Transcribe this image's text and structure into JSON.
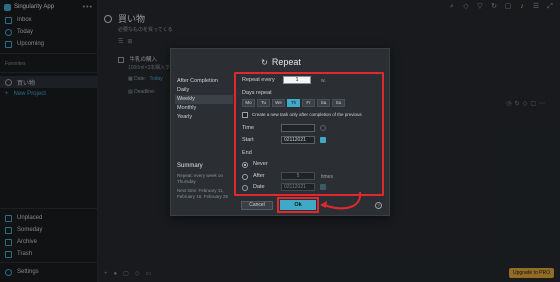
{
  "app": {
    "title": "Singularity App"
  },
  "sidebar": {
    "items": [
      {
        "label": "Inbox"
      },
      {
        "label": "Today"
      },
      {
        "label": "Upcoming"
      }
    ],
    "favorites_label": "Favorites",
    "projects": [
      {
        "label": "買い物"
      }
    ],
    "new_project_label": "New Project",
    "bottom_items": [
      {
        "label": "Unplaced"
      },
      {
        "label": "Someday"
      },
      {
        "label": "Archive"
      },
      {
        "label": "Trash"
      }
    ],
    "settings_label": "Settings"
  },
  "main": {
    "project_title": "買い物",
    "project_subtitle": "必要なものを買ってくる",
    "task_title": "牛乳の購入",
    "task_note": "1000ml×3本購入す",
    "date_label": "Date:",
    "date_value": "Today",
    "deadline_label": "Deadline:",
    "upgrade_label": "Upgrade to PRO"
  },
  "modal": {
    "title": "Repeat",
    "frequencies": [
      "After Completion",
      "Daily",
      "Weekly",
      "Monthly",
      "Yearly"
    ],
    "selected_frequency": "Weekly",
    "repeat_every_label": "Repeat every",
    "repeat_every_value": "1",
    "repeat_every_unit": "w.",
    "days_repeat_label": "Days repeat",
    "days": [
      "Mo",
      "Tu",
      "We",
      "Th",
      "Fr",
      "Sa",
      "Su"
    ],
    "selected_day": "Th",
    "create_new_label": "Create a new task only after completion of the previous",
    "time_label": "Time",
    "start_label": "Start",
    "start_value": "02112021",
    "end_label": "End",
    "never_label": "Never",
    "after_label": "After",
    "after_value": "5",
    "after_unit": "times",
    "date_label": "Date",
    "date_value": "02112021",
    "summary_head": "Summary",
    "summary_text": "Repeat: every week on Thursday",
    "next_time_text": "Next time: February 11, February 18, February 25",
    "cancel_label": "Cancel",
    "ok_label": "Ok"
  },
  "colors": {
    "accent": "#3fa9c8",
    "highlight": "#e0282f",
    "upgrade": "#e0a53a"
  }
}
